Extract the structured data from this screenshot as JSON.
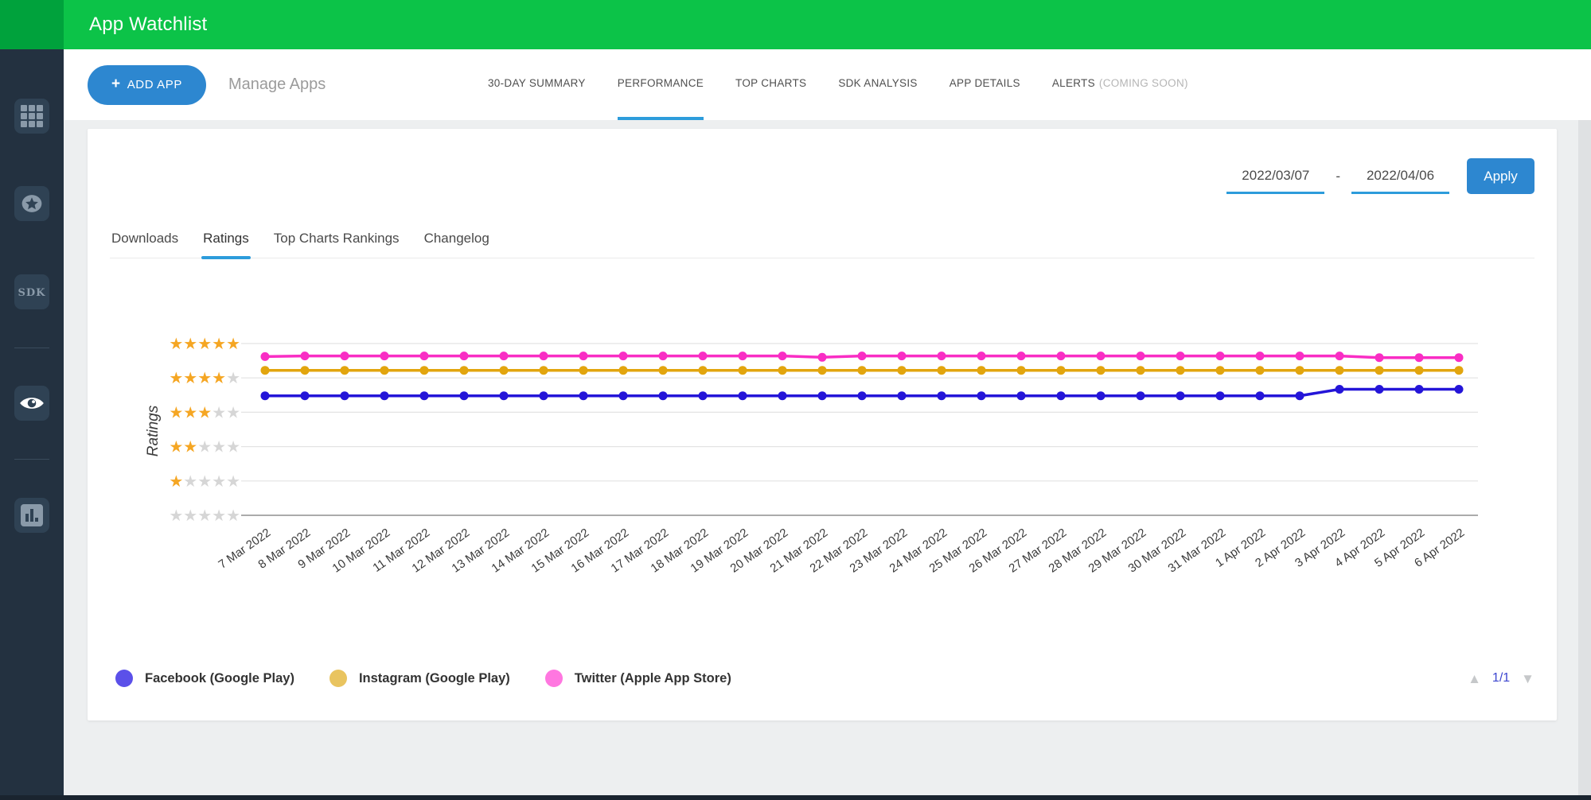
{
  "header": {
    "title": "App Watchlist"
  },
  "sidebar": {
    "items": [
      {
        "icon": "apps-grid-icon",
        "active": false
      },
      {
        "icon": "featured-star-icon",
        "active": false
      },
      {
        "icon": "sdk-icon",
        "label": "SDK",
        "active": false
      },
      {
        "icon": "watchlist-eye-icon",
        "active": true
      },
      {
        "icon": "analytics-bars-icon",
        "active": false
      }
    ]
  },
  "toolbar": {
    "add_app": {
      "plus": "+",
      "label": "ADD APP"
    },
    "manage_apps_label": "Manage Apps",
    "tabs": [
      {
        "label": "30-DAY SUMMARY",
        "active": false
      },
      {
        "label": "PERFORMANCE",
        "active": true
      },
      {
        "label": "TOP CHARTS",
        "active": false
      },
      {
        "label": "SDK ANALYSIS",
        "active": false
      },
      {
        "label": "APP DETAILS",
        "active": false
      },
      {
        "label": "ALERTS",
        "suffix": "(COMING SOON)",
        "active": false
      }
    ]
  },
  "filters": {
    "date_from": "2022/03/07",
    "separator": "-",
    "date_to": "2022/04/06",
    "apply_label": "Apply"
  },
  "subtabs": [
    {
      "label": "Downloads",
      "active": false
    },
    {
      "label": "Ratings",
      "active": true
    },
    {
      "label": "Top Charts Rankings",
      "active": false
    },
    {
      "label": "Changelog",
      "active": false
    }
  ],
  "chart_data": {
    "type": "line",
    "title": "",
    "ylabel": "Ratings",
    "y_axis": {
      "min": 0,
      "max": 5,
      "tick_step": 1,
      "tick_style": "stars",
      "star_filled_color": "#f5a623",
      "star_empty_color": "#d6d6d6"
    },
    "grid": true,
    "legend_position": "bottom-left",
    "x_tick_rotation": -35,
    "x": [
      "7 Mar 2022",
      "8 Mar 2022",
      "9 Mar 2022",
      "10 Mar 2022",
      "11 Mar 2022",
      "12 Mar 2022",
      "13 Mar 2022",
      "14 Mar 2022",
      "15 Mar 2022",
      "16 Mar 2022",
      "17 Mar 2022",
      "18 Mar 2022",
      "19 Mar 2022",
      "20 Mar 2022",
      "21 Mar 2022",
      "22 Mar 2022",
      "23 Mar 2022",
      "24 Mar 2022",
      "25 Mar 2022",
      "26 Mar 2022",
      "27 Mar 2022",
      "28 Mar 2022",
      "29 Mar 2022",
      "30 Mar 2022",
      "31 Mar 2022",
      "1 Apr 2022",
      "2 Apr 2022",
      "3 Apr 2022",
      "4 Apr 2022",
      "5 Apr 2022",
      "6 Apr 2022"
    ],
    "series": [
      {
        "name": "Facebook (Google Play)",
        "line_color": "#2415d8",
        "legend_color": "#5b50e9",
        "values": [
          3.48,
          3.48,
          3.48,
          3.48,
          3.48,
          3.48,
          3.48,
          3.48,
          3.48,
          3.48,
          3.48,
          3.48,
          3.48,
          3.48,
          3.48,
          3.48,
          3.48,
          3.48,
          3.48,
          3.48,
          3.48,
          3.48,
          3.48,
          3.48,
          3.48,
          3.48,
          3.48,
          3.67,
          3.67,
          3.67,
          3.67
        ]
      },
      {
        "name": "Instagram (Google Play)",
        "line_color": "#e2a50e",
        "legend_color": "#e9c45f",
        "values": [
          4.22,
          4.22,
          4.22,
          4.22,
          4.22,
          4.22,
          4.22,
          4.22,
          4.22,
          4.22,
          4.22,
          4.22,
          4.22,
          4.22,
          4.22,
          4.22,
          4.22,
          4.22,
          4.22,
          4.22,
          4.22,
          4.22,
          4.22,
          4.22,
          4.22,
          4.22,
          4.22,
          4.22,
          4.22,
          4.22,
          4.22
        ]
      },
      {
        "name": "Twitter (Apple App Store)",
        "line_color": "#f92dc4",
        "legend_color": "#ff77e0",
        "values": [
          4.62,
          4.64,
          4.64,
          4.64,
          4.64,
          4.64,
          4.64,
          4.64,
          4.64,
          4.64,
          4.64,
          4.64,
          4.64,
          4.64,
          4.6,
          4.64,
          4.64,
          4.64,
          4.64,
          4.64,
          4.64,
          4.64,
          4.64,
          4.64,
          4.64,
          4.64,
          4.64,
          4.64,
          4.59,
          4.59,
          4.59
        ]
      }
    ]
  },
  "pagination": {
    "up_icon": "up-triangle-icon",
    "label": "1/1",
    "down_icon": "down-triangle-icon"
  }
}
